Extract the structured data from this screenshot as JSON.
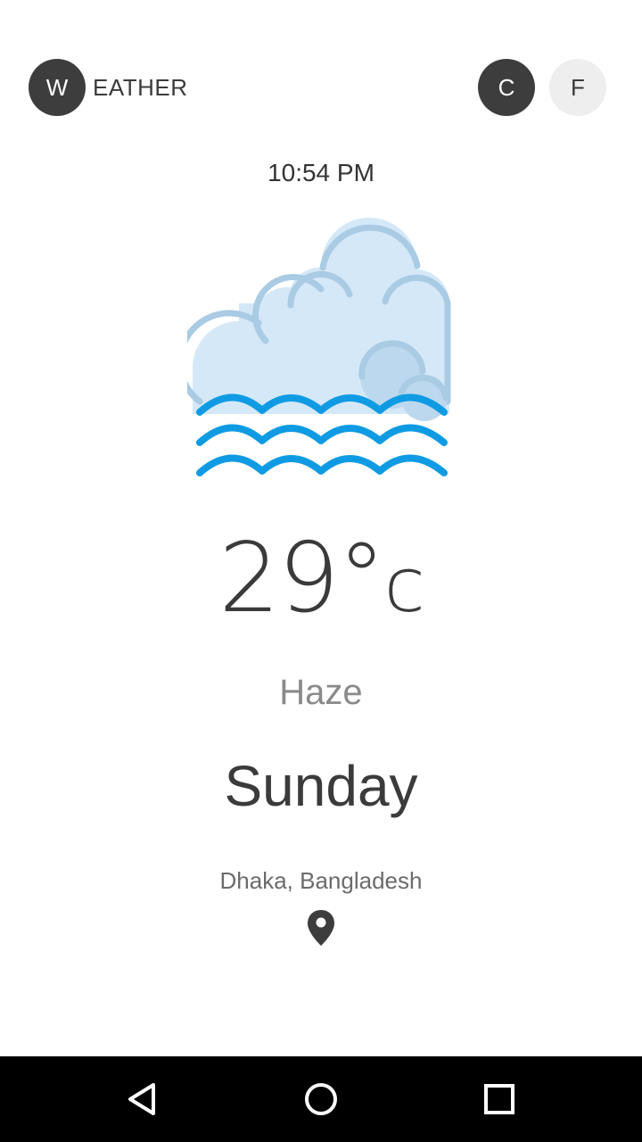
{
  "header": {
    "logo_letter": "W",
    "logo_rest": "EATHER",
    "unit_c": "C",
    "unit_f": "F",
    "selected_unit": "C"
  },
  "weather": {
    "time": "10:54 PM",
    "icon": "haze-cloud-icon",
    "temperature": "29°",
    "temperature_unit": "c",
    "condition": "Haze",
    "day": "Sunday",
    "location": "Dhaka, Bangladesh",
    "location_icon": "map-pin-icon"
  },
  "colors": {
    "dark_circle": "#3d3d3d",
    "light_circle": "#eeeeee",
    "cloud_fill": "#d4e8f8",
    "cloud_stroke": "#a9cbe3",
    "haze_waves": "#0f9be3",
    "navbar": "#000000"
  },
  "navigation_bar": {
    "back": "back-icon",
    "home": "home-icon",
    "recent": "recent-apps-icon"
  }
}
